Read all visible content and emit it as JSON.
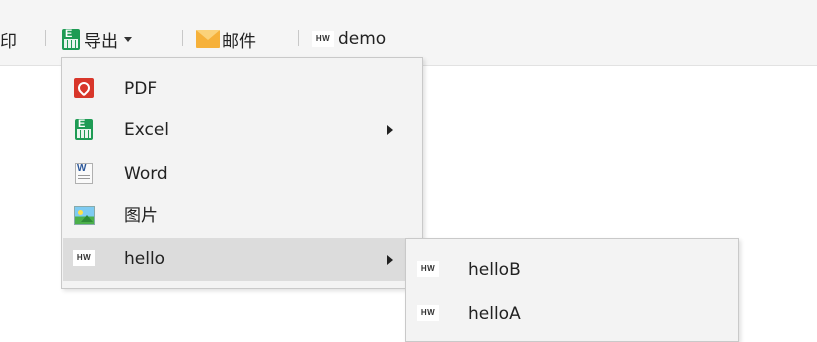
{
  "toolbar": {
    "print_label": "印",
    "export_label": "导出",
    "mail_label": "邮件",
    "demo_badge": "HW",
    "demo_label": "demo"
  },
  "export_menu": {
    "items": [
      {
        "label": "PDF",
        "icon": "pdf-icon",
        "has_submenu": false
      },
      {
        "label": "Excel",
        "icon": "excel-icon",
        "has_submenu": true
      },
      {
        "label": "Word",
        "icon": "word-icon",
        "has_submenu": false
      },
      {
        "label": "图片",
        "icon": "image-icon",
        "has_submenu": false
      },
      {
        "label": "hello",
        "badge": "HW",
        "icon": "hw-icon",
        "has_submenu": true
      }
    ]
  },
  "hello_submenu": {
    "items": [
      {
        "label": "helloB",
        "badge": "HW",
        "icon": "hw-icon"
      },
      {
        "label": "helloA",
        "badge": "HW",
        "icon": "hw-icon"
      }
    ]
  },
  "colors": {
    "toolbar_bg": "#f5f5f5",
    "menu_bg": "#f3f3f3",
    "hover_bg": "#dcdcdc",
    "excel_green": "#1e9b54",
    "pdf_red": "#d8362a",
    "mail_orange": "#f6b13a"
  }
}
